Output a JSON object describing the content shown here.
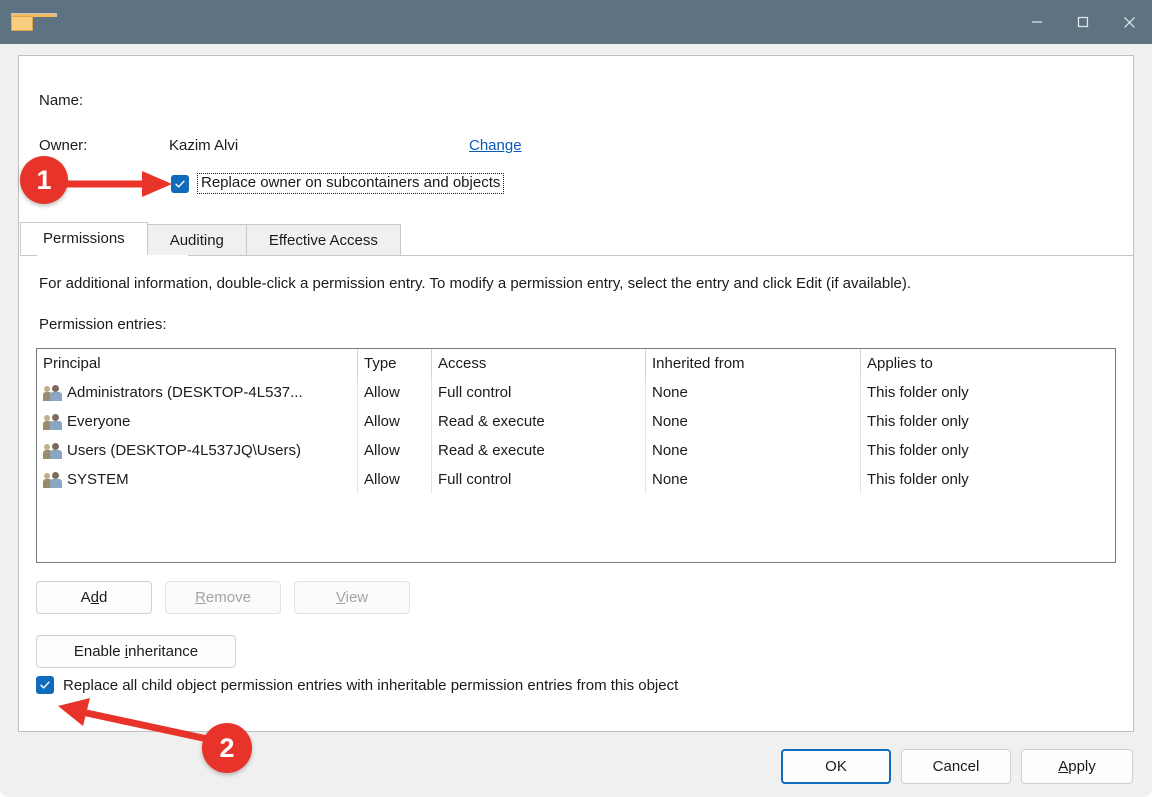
{
  "window": {
    "title": "",
    "icon": "folder-icon",
    "controls": {
      "minimize": "minimize-icon",
      "maximize": "maximize-icon",
      "close": "close-icon"
    },
    "titlebar_color": "#5d7382"
  },
  "header": {
    "name_label": "Name:",
    "name_value": "",
    "owner_label": "Owner:",
    "owner_value": "Kazim Alvi",
    "change_link": "Change",
    "replace_owner_checkbox": {
      "label": "Replace owner on subcontainers and objects",
      "checked": true,
      "focused": true
    }
  },
  "tabs": [
    {
      "label": "Permissions",
      "active": true
    },
    {
      "label": "Auditing",
      "active": false
    },
    {
      "label": "Effective Access",
      "active": false
    }
  ],
  "main": {
    "info_text": "For additional information, double-click a permission entry. To modify a permission entry, select the entry and click Edit (if available).",
    "entries_label": "Permission entries:",
    "columns": [
      "Principal",
      "Type",
      "Access",
      "Inherited from",
      "Applies to"
    ],
    "rows": [
      {
        "icon": "users-group-icon",
        "principal": "Administrators (DESKTOP-4L537...",
        "type": "Allow",
        "access": "Full control",
        "inherited_from": "None",
        "applies_to": "This folder only"
      },
      {
        "icon": "users-group-icon",
        "principal": "Everyone",
        "type": "Allow",
        "access": "Read & execute",
        "inherited_from": "None",
        "applies_to": "This folder only"
      },
      {
        "icon": "users-group-icon",
        "principal": "Users (DESKTOP-4L537JQ\\Users)",
        "type": "Allow",
        "access": "Read & execute",
        "inherited_from": "None",
        "applies_to": "This folder only"
      },
      {
        "icon": "users-group-icon",
        "principal": "SYSTEM",
        "type": "Allow",
        "access": "Full control",
        "inherited_from": "None",
        "applies_to": "This folder only"
      }
    ]
  },
  "actions": {
    "add": {
      "label": "Add",
      "accel": "d",
      "enabled": true
    },
    "remove": {
      "label": "Remove",
      "accel": "R",
      "enabled": false
    },
    "view": {
      "label": "View",
      "accel": "V",
      "enabled": false
    },
    "enable_inheritance": {
      "label": "Enable inheritance",
      "accel": "i",
      "enabled": true
    }
  },
  "replace_child_checkbox": {
    "label": "Replace all child object permission entries with inheritable permission entries from this object",
    "checked": true
  },
  "footer": {
    "ok": "OK",
    "cancel": "Cancel",
    "apply": "Apply",
    "apply_accel": "A"
  },
  "annotations": [
    {
      "id": "1",
      "label": "1",
      "color": "#e8332a",
      "points_to": "replace-owner-checkbox"
    },
    {
      "id": "2",
      "label": "2",
      "color": "#e8332a",
      "points_to": "replace-child-checkbox"
    }
  ]
}
